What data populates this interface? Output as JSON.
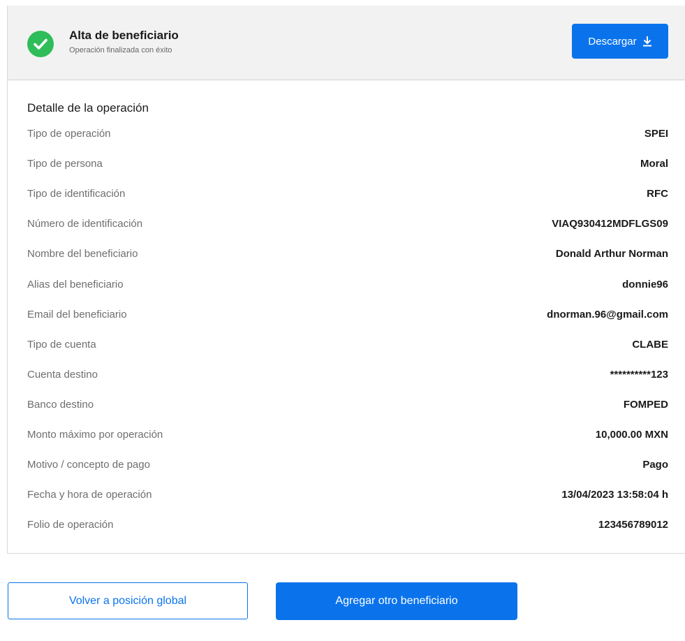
{
  "header": {
    "title": "Alta de beneficiario",
    "subtitle": "Operación finalizada con éxito",
    "download_label": "Descargar",
    "status_color": "#2ebd59",
    "accent_color": "#0a73ec"
  },
  "details": {
    "title": "Detalle de la operación",
    "rows": [
      {
        "label": "Tipo de operación",
        "value": "SPEI"
      },
      {
        "label": "Tipo de persona",
        "value": "Moral"
      },
      {
        "label": "Tipo de identificación",
        "value": "RFC"
      },
      {
        "label": "Número de identificación",
        "value": "VIAQ930412MDFLGS09"
      },
      {
        "label": "Nombre del beneficiario",
        "value": "Donald Arthur Norman"
      },
      {
        "label": "Alias del beneficiario",
        "value": "donnie96"
      },
      {
        "label": "Email del beneficiario",
        "value": "dnorman.96@gmail.com"
      },
      {
        "label": "Tipo de cuenta",
        "value": "CLABE"
      },
      {
        "label": "Cuenta destino",
        "value": "**********123"
      },
      {
        "label": "Banco destino",
        "value": "FOMPED"
      },
      {
        "label": "Monto máximo por operación",
        "value": "10,000.00 MXN"
      },
      {
        "label": "Motivo / concepto de pago",
        "value": "Pago"
      },
      {
        "label": "Fecha y hora de operación",
        "value": "13/04/2023 13:58:04 h"
      },
      {
        "label": "Folio de operación",
        "value": "123456789012"
      }
    ]
  },
  "actions": {
    "back_label": "Volver a posición global",
    "add_label": "Agregar otro beneficiario"
  }
}
